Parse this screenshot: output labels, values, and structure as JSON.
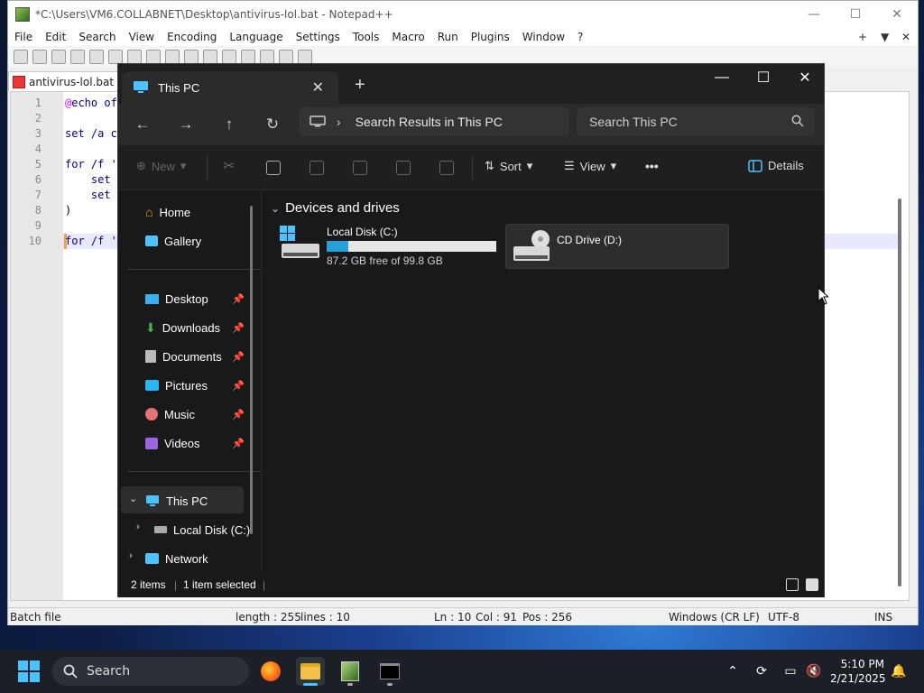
{
  "notepadpp": {
    "title": "*C:\\Users\\VM6.COLLABNET\\Desktop\\antivirus-lol.bat - Notepad++",
    "menu": [
      "File",
      "Edit",
      "Search",
      "View",
      "Encoding",
      "Language",
      "Settings",
      "Tools",
      "Macro",
      "Run",
      "Plugins",
      "Window",
      "?"
    ],
    "menu_right": {
      "plus": "+",
      "down": "▼",
      "close": "✕"
    },
    "tab_label": "antivirus-lol.bat",
    "line_numbers": [
      "1",
      "2",
      "3",
      "4",
      "5",
      "6",
      "7",
      "8",
      "9",
      "10"
    ],
    "code_lines": [
      "echo of",
      "",
      "set /a c",
      "",
      "for /f '",
      "    set",
      "    set",
      ")",
      "",
      "for /f '"
    ],
    "status": {
      "type": "Batch file",
      "length": "length : 255",
      "lines": "lines : 10",
      "ln": "Ln : 10",
      "col": "Col : 91",
      "pos": "Pos : 256",
      "eol": "Windows (CR LF)",
      "encoding": "UTF-8",
      "mode": "INS"
    }
  },
  "explorer": {
    "tab_title": "This PC",
    "address": "Search Results in This PC",
    "search_placeholder": "Search This PC",
    "commands": {
      "new": "New",
      "sort": "Sort",
      "view": "View",
      "more": "•••",
      "details": "Details"
    },
    "nav": {
      "home": "Home",
      "gallery": "Gallery",
      "desktop": "Desktop",
      "downloads": "Downloads",
      "documents": "Documents",
      "pictures": "Pictures",
      "music": "Music",
      "videos": "Videos",
      "this_pc": "This PC",
      "local_disk": "Local Disk (C:)",
      "network": "Network"
    },
    "section": "Devices and drives",
    "drives": [
      {
        "name": "Local Disk (C:)",
        "free": "87.2 GB free of 99.8 GB",
        "used_fraction": 0.126
      },
      {
        "name": "CD Drive (D:)"
      }
    ],
    "status": {
      "items": "2 items",
      "selected": "1 item selected"
    }
  },
  "taskbar": {
    "search_label": "Search",
    "time": "5:10 PM",
    "date": "2/21/2025"
  },
  "colors": {
    "accent": "#4cc2ff",
    "drive_bar": "#26a0da"
  }
}
